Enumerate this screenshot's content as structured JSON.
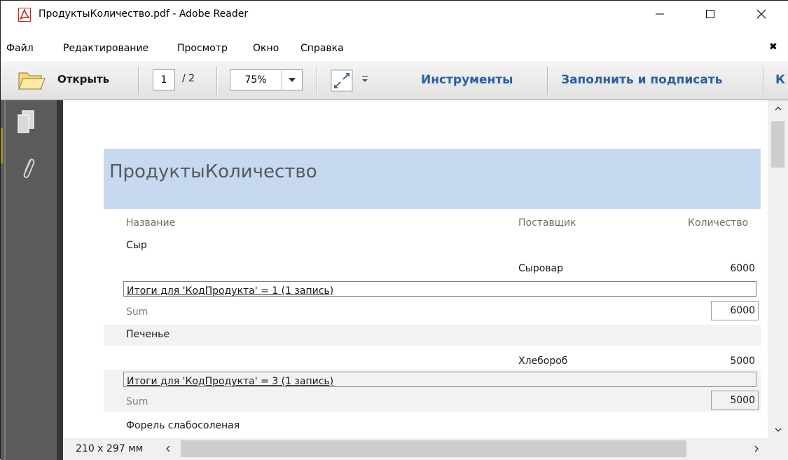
{
  "window": {
    "title": "ПродуктыКоличество.pdf - Adobe Reader",
    "controls": {
      "minimize_icon": "minimize-icon",
      "maximize_icon": "maximize-icon",
      "close_icon": "close-icon"
    }
  },
  "menu": {
    "items": [
      "Файл",
      "Редактирование",
      "Просмотр",
      "Окно",
      "Справка"
    ],
    "close_glyph": "✖"
  },
  "toolbar": {
    "open_label": "Открыть",
    "page_current": "1",
    "page_total": "/ 2",
    "zoom_value": "75%",
    "tools_label": "Инструменты",
    "fill_sign_label": "Заполнить и подписать",
    "cut_label": "К"
  },
  "status": {
    "page_size": "210 x 297 мм"
  },
  "report": {
    "title": "ПродуктыКоличество",
    "columns": {
      "name": "Название",
      "supplier": "Поставщик",
      "quantity": "Количество"
    },
    "groups": [
      {
        "product": "Сыр",
        "supplier": "Сыровар",
        "quantity": "6000",
        "total_label": "Итоги для 'КодПродукта' =  1 (1 запись)",
        "sum_label": "Sum",
        "sum_value": "6000"
      },
      {
        "product": "Печенье",
        "supplier": "Хлебороб",
        "quantity": "5000",
        "total_label": "Итоги для 'КодПродукта' =  3 (1 запись)",
        "sum_label": "Sum",
        "sum_value": "5000"
      },
      {
        "product": "Форель слабосоленая"
      }
    ]
  },
  "colors": {
    "link_blue": "#2b5fa5",
    "report_header_bg": "#c6d9f1",
    "nav_rail": "#5b5b5b",
    "band_gray": "#f2f2f2"
  }
}
